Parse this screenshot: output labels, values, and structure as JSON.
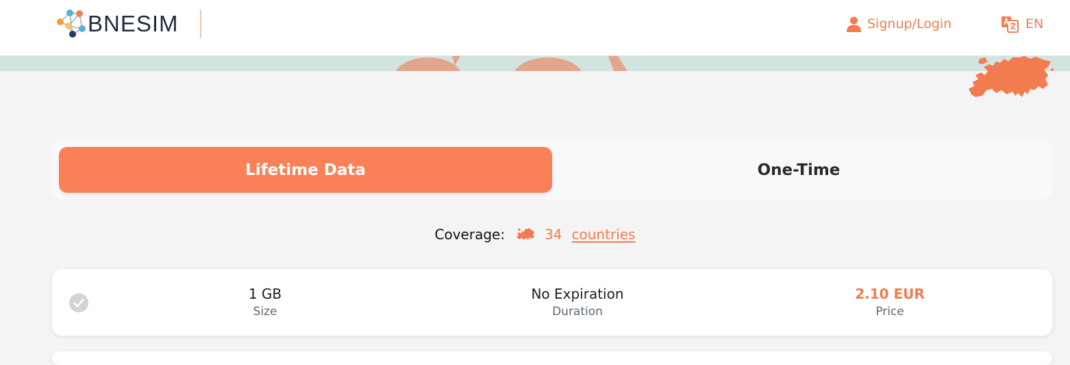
{
  "header": {
    "brand": "BNESIM",
    "login_label": "Signup/Login",
    "language": "EN"
  },
  "tabs": {
    "active_label": "Lifetime Data",
    "inactive_label": "One-Time"
  },
  "coverage": {
    "label": "Coverage:",
    "count": "34",
    "link_label": "countries"
  },
  "offer": {
    "size_value": "1 GB",
    "size_label": "Size",
    "duration_value": "No Expiration",
    "duration_label": "Duration",
    "price_value": "2.10 EUR",
    "price_label": "Price"
  },
  "colors": {
    "accent": "#f98057",
    "accent_text": "#f27b50",
    "banner": "#d3e3e0",
    "page_bg": "#f4f4f4"
  },
  "icons": {
    "logo": "network-molecule-icon",
    "login": "user-icon",
    "language": "translate-icon",
    "coverage": "europe-map-icon",
    "select": "check-circle-icon"
  }
}
